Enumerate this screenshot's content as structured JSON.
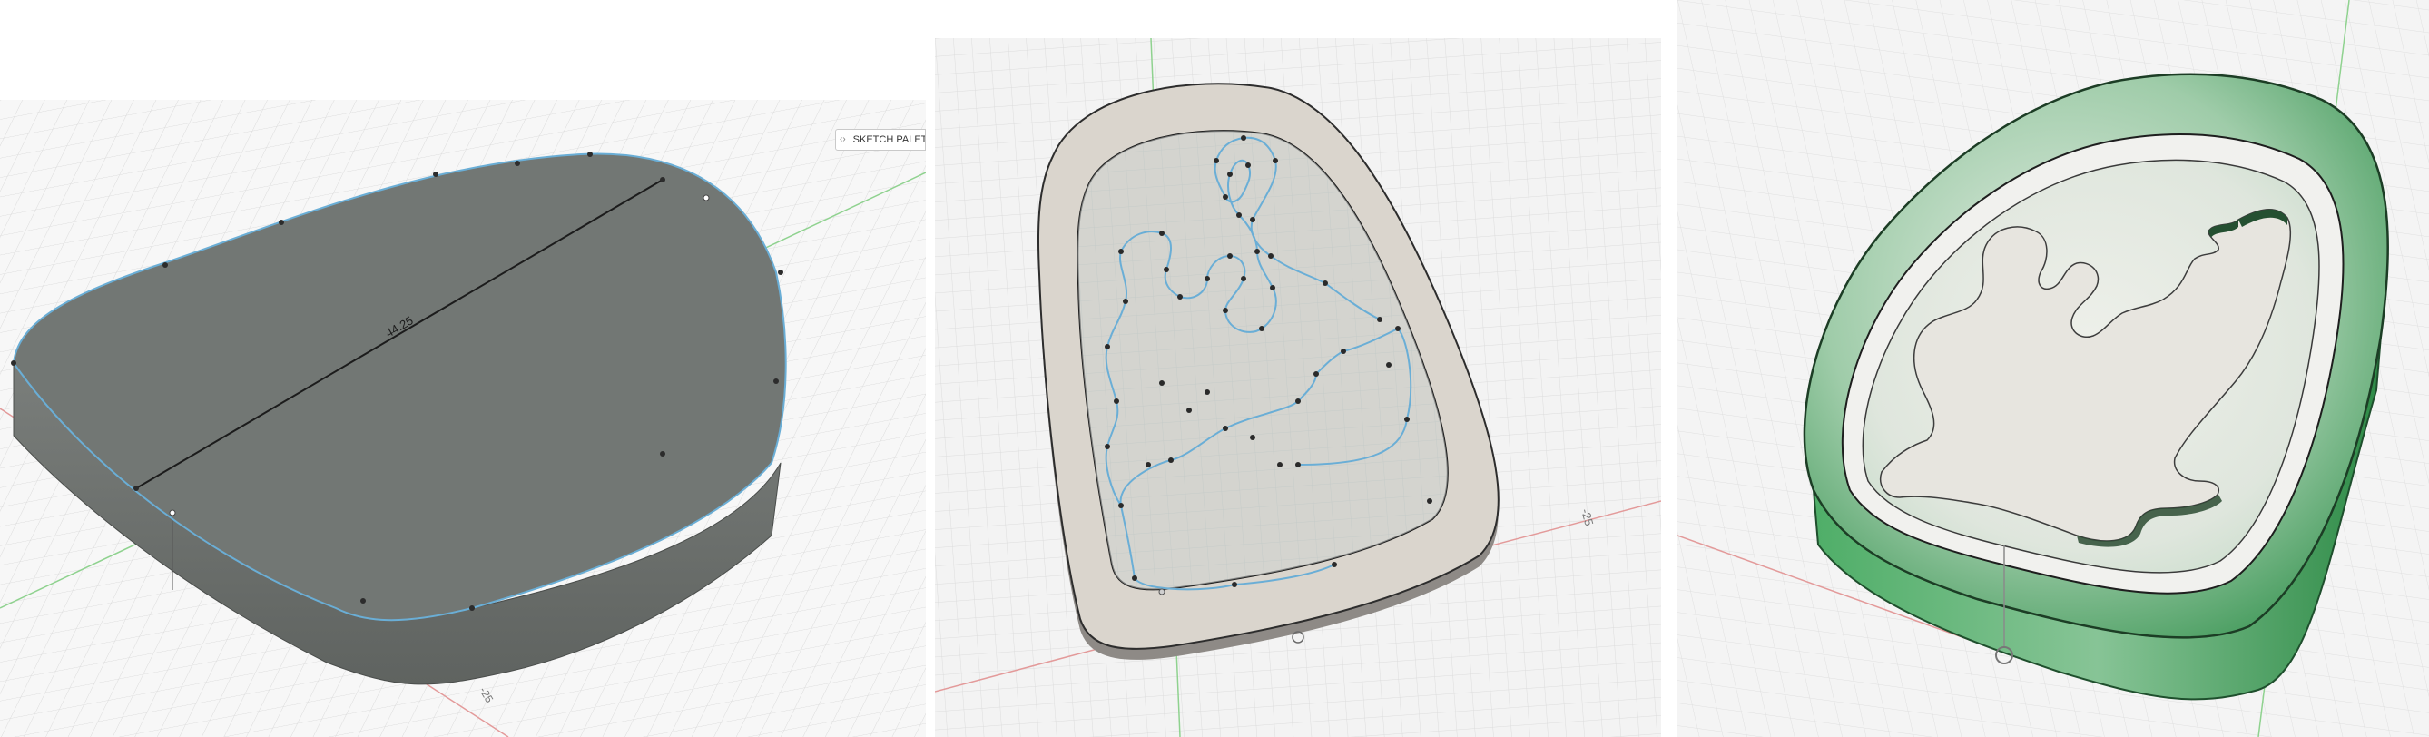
{
  "panels": [
    {
      "id": "extruded-body-view",
      "dimension_label": "44.25",
      "axis_label": "-25",
      "palette_label": "SKETCH PALETTE",
      "palette_collapse_glyph": "‹›"
    },
    {
      "id": "sketch-spline-view",
      "axis_label": "-25"
    },
    {
      "id": "rendered-mold-view"
    }
  ],
  "colors": {
    "body_top": "#727774",
    "body_side": "#6c706d",
    "sketch_curve": "#6aaed6",
    "x_axis": "#e38a8a",
    "y_axis": "#7ccc7c",
    "frame_fill": "#dad5cd",
    "recess_fill": "#cfd4d1",
    "mold_green": "#3e9a56"
  },
  "icons": [
    "collapse-arrows-icon",
    "sketch-palette-dot-icon"
  ]
}
